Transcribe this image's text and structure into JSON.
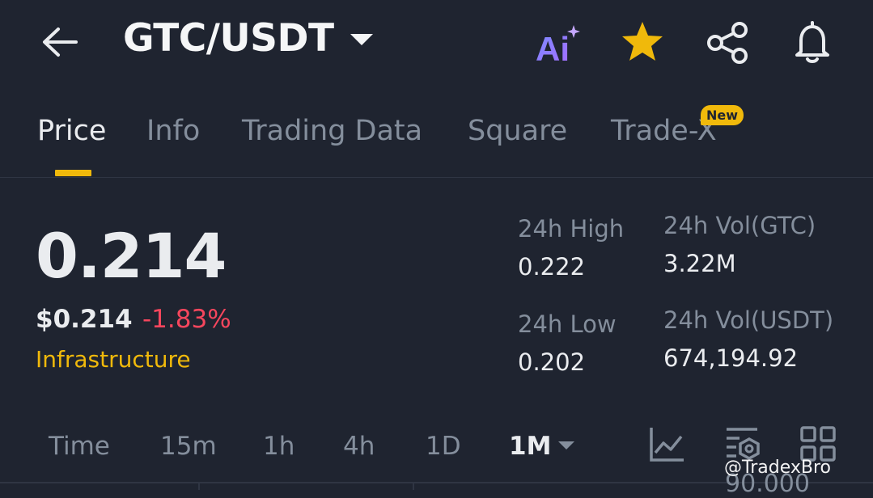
{
  "header": {
    "pair": "GTC/USDT",
    "icons": [
      "back-arrow-icon",
      "dropdown-caret-icon",
      "ai-icon",
      "star-icon",
      "share-icon",
      "bell-icon"
    ],
    "ai_label": "Ai",
    "favorite_color": "#f0b90b"
  },
  "tabs": [
    {
      "label": "Price"
    },
    {
      "label": "Info"
    },
    {
      "label": "Trading Data"
    },
    {
      "label": "Square"
    },
    {
      "label": "Trade-X",
      "badge": "New"
    }
  ],
  "price": {
    "last": "0.214",
    "fiat": "$0.214",
    "change": "-1.83%",
    "tag": "Infrastructure",
    "change_color": "#f6465d"
  },
  "stats": {
    "high_label": "24h High",
    "high_value": "0.222",
    "low_label": "24h Low",
    "low_value": "0.202",
    "vol_base_label": "24h Vol(GTC)",
    "vol_base_value": "3.22M",
    "vol_quote_label": "24h Vol(USDT)",
    "vol_quote_value": "674,194.92"
  },
  "timeframes": {
    "items": [
      "Time",
      "15m",
      "1h",
      "4h",
      "1D",
      "1M"
    ],
    "selected": "1M"
  },
  "toolbar_icons": [
    "chart-indicator-icon",
    "chart-settings-icon",
    "grid-layout-icon"
  ],
  "chart": {
    "axis_label": "90.000"
  },
  "watermark": "@TradexBro"
}
